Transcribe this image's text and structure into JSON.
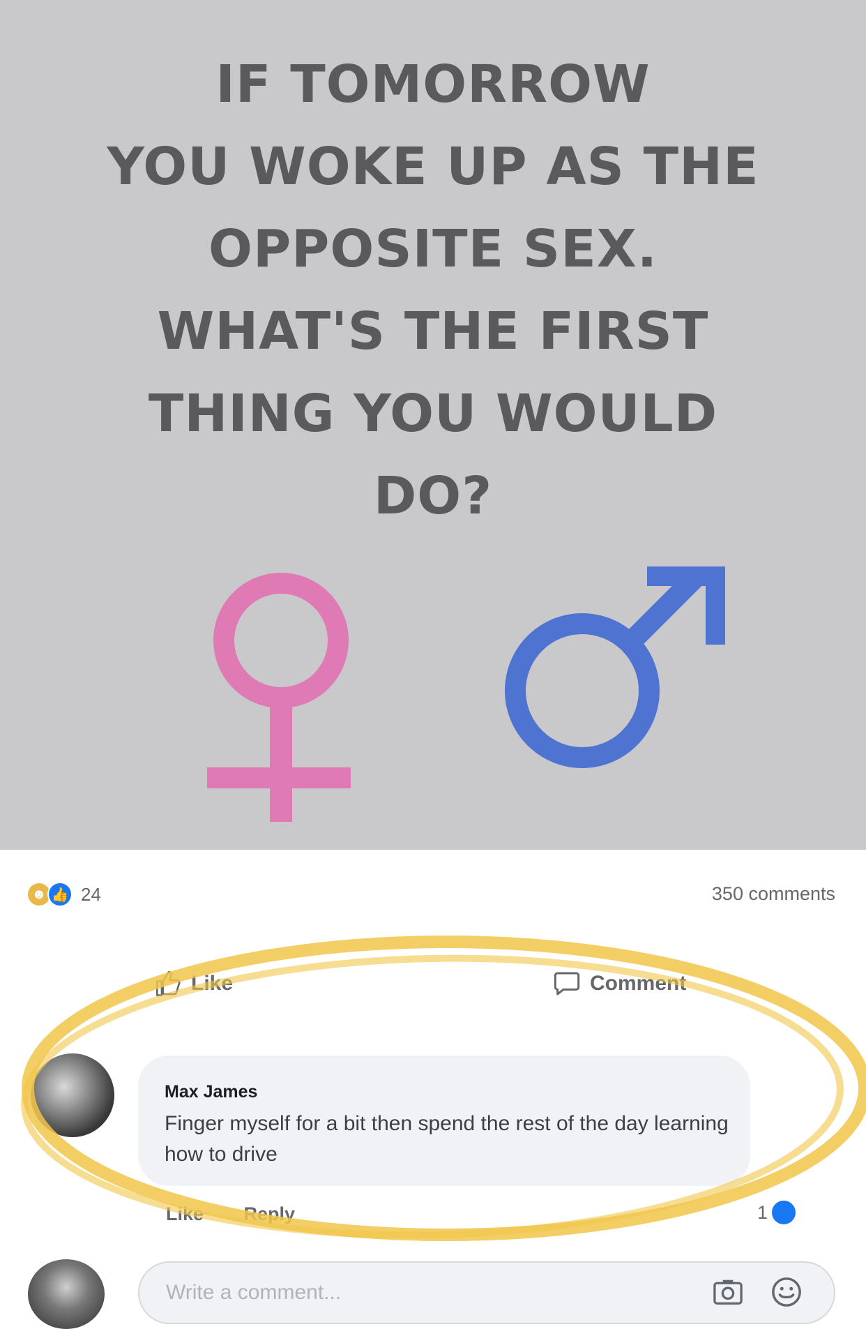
{
  "post": {
    "headline_lines": [
      "IF TOMORROW",
      "YOU WOKE UP AS THE",
      "OPPOSITE SEX.",
      "WHAT'S THE FIRST",
      "THING YOU WOULD",
      "DO?"
    ],
    "symbol_colors": {
      "female": "#e07ab5",
      "male": "#4f73d1"
    },
    "background_color": "#c9c9cb"
  },
  "reactions": {
    "icons": [
      "haha-icon",
      "like-icon"
    ],
    "count": "24",
    "comments_count": "350 comments"
  },
  "actions": {
    "like_label": "Like",
    "comment_label": "Comment"
  },
  "comment": {
    "author": "Max James",
    "text": "Finger myself for a bit then spend the rest of the day learning how to drive",
    "like_label": "Like",
    "reply_label": "Reply",
    "reaction_count": "1",
    "highlight_color": "#f0c64a"
  },
  "composer": {
    "placeholder": "Write a comment...",
    "icons": [
      "camera-icon",
      "emoji-icon"
    ]
  },
  "colors": {
    "accent": "#1877f2",
    "muted_text": "#65676b",
    "bubble_bg": "#f0f2f5"
  }
}
